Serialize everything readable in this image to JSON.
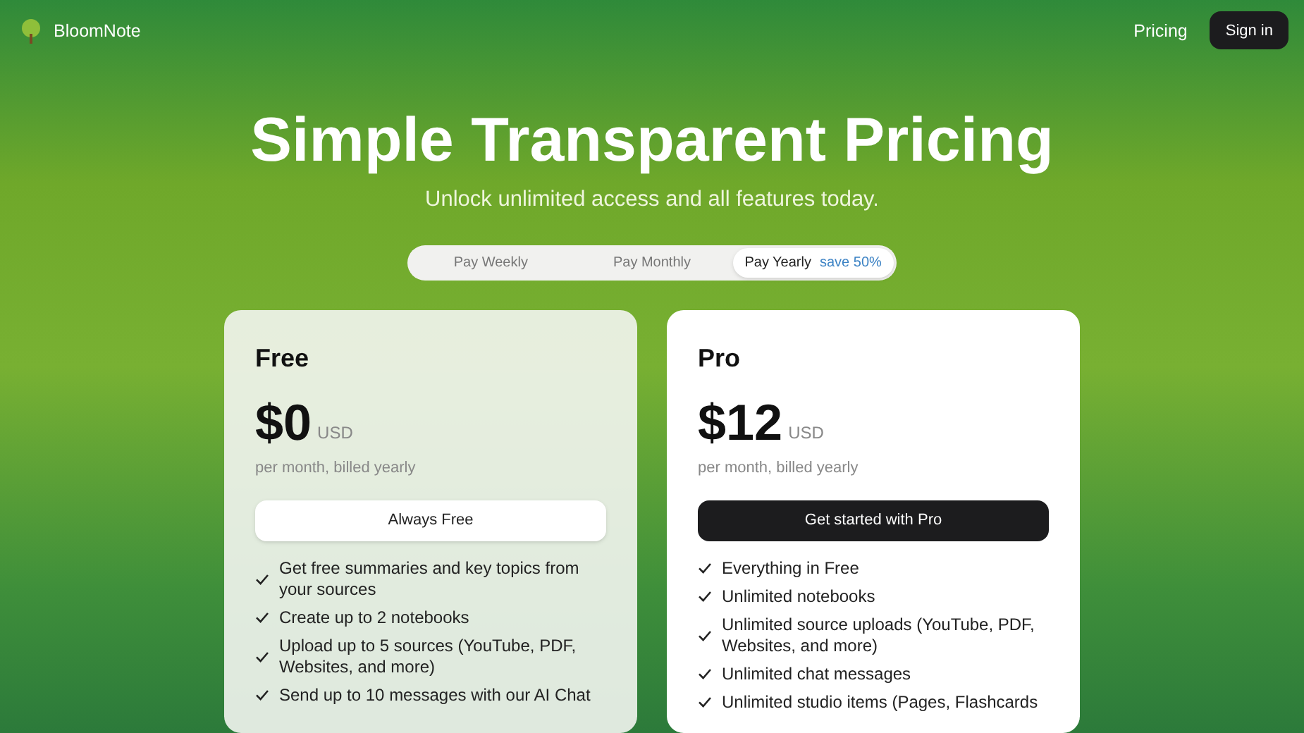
{
  "nav": {
    "brand": "BloomNote",
    "links": [
      "Pricing"
    ],
    "sign_in": "Sign in"
  },
  "hero": {
    "title": "Simple Transparent Pricing",
    "subtitle": "Unlock unlimited access and all features today."
  },
  "billing_tabs": [
    {
      "label": "Pay Weekly",
      "selected": false
    },
    {
      "label": "Pay Monthly",
      "selected": false
    },
    {
      "label": "Pay Yearly",
      "selected": true,
      "badge": "save 50%"
    }
  ],
  "plans": [
    {
      "name": "Free",
      "price": "$0",
      "currency": "USD",
      "period": "per month, billed yearly",
      "button": "Always Free",
      "kind": "basic",
      "features": [
        "Get free summaries and key topics from your sources",
        "Create up to 2 notebooks",
        "Upload up to 5 sources (YouTube, PDF, Websites, and more)",
        "Send up to 10 messages with our AI Chat"
      ]
    },
    {
      "name": "Pro",
      "price": "$12",
      "currency": "USD",
      "period": "per month, billed yearly",
      "button": "Get started with Pro",
      "kind": "featured",
      "features": [
        "Everything in Free",
        "Unlimited notebooks",
        "Unlimited source uploads (YouTube, PDF, Websites, and more)",
        "Unlimited chat messages",
        "Unlimited studio items (Pages, Flashcards"
      ]
    }
  ]
}
